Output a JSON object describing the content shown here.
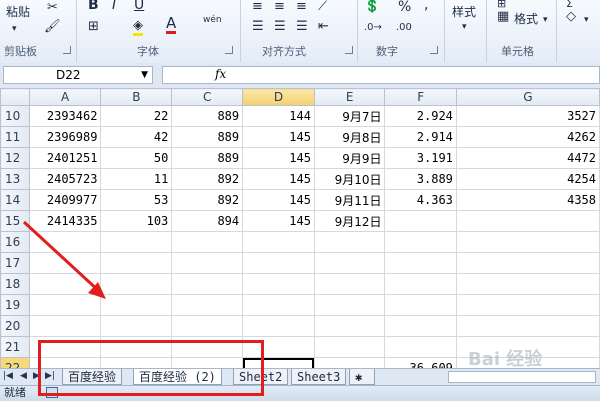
{
  "ribbon": {
    "clipboard": {
      "label": "剪贴板",
      "paste_label": "粘贴"
    },
    "font": {
      "label": "字体",
      "bold": "B",
      "italic": "I",
      "underline": "U",
      "font_color_glyph": "A",
      "wen_glyph": "wén"
    },
    "align": {
      "label": "对齐方式"
    },
    "number": {
      "label": "数字",
      "percent": "%",
      "comma": ","
    },
    "styles": {
      "label": "样式"
    },
    "cells": {
      "label": "单元格",
      "format_label": "格式"
    }
  },
  "formula_bar": {
    "name_box": "D22",
    "fx": "fx",
    "formula": ""
  },
  "columns": [
    "A",
    "B",
    "C",
    "D",
    "E",
    "F",
    "G"
  ],
  "selected_column": "D",
  "rows": [
    {
      "n": "10",
      "a": "2393462",
      "b": "22",
      "c": "889",
      "d": "144",
      "e": "9月7日",
      "f": "2.924",
      "g": "3527"
    },
    {
      "n": "11",
      "a": "2396989",
      "b": "42",
      "c": "889",
      "d": "145",
      "e": "9月8日",
      "f": "2.914",
      "g": "4262"
    },
    {
      "n": "12",
      "a": "2401251",
      "b": "50",
      "c": "889",
      "d": "145",
      "e": "9月9日",
      "f": "3.191",
      "g": "4472"
    },
    {
      "n": "13",
      "a": "2405723",
      "b": "11",
      "c": "892",
      "d": "145",
      "e": "9月10日",
      "f": "3.889",
      "g": "4254"
    },
    {
      "n": "14",
      "a": "2409977",
      "b": "53",
      "c": "892",
      "d": "145",
      "e": "9月11日",
      "f": "4.363",
      "g": "4358"
    },
    {
      "n": "15",
      "a": "2414335",
      "b": "103",
      "c": "894",
      "d": "145",
      "e": "9月12日",
      "f": "",
      "g": ""
    },
    {
      "n": "16",
      "a": "",
      "b": "",
      "c": "",
      "d": "",
      "e": "",
      "f": "",
      "g": ""
    },
    {
      "n": "17",
      "a": "",
      "b": "",
      "c": "",
      "d": "",
      "e": "",
      "f": "",
      "g": ""
    },
    {
      "n": "18",
      "a": "",
      "b": "",
      "c": "",
      "d": "",
      "e": "",
      "f": "",
      "g": ""
    },
    {
      "n": "19",
      "a": "",
      "b": "",
      "c": "",
      "d": "",
      "e": "",
      "f": "",
      "g": ""
    },
    {
      "n": "20",
      "a": "",
      "b": "",
      "c": "",
      "d": "",
      "e": "",
      "f": "",
      "g": ""
    },
    {
      "n": "21",
      "a": "",
      "b": "",
      "c": "",
      "d": "",
      "e": "",
      "f": "",
      "g": ""
    },
    {
      "n": "22",
      "a": "",
      "b": "",
      "c": "",
      "d": "",
      "e": "",
      "f": "36.609",
      "g": ""
    },
    {
      "n": "23",
      "a": "",
      "b": "",
      "c": "",
      "d": "",
      "e": "",
      "f": "",
      "g": ""
    }
  ],
  "active_cell": {
    "row": "22",
    "col": "D"
  },
  "sheet_tabs": [
    {
      "label": "百度经验",
      "active": false
    },
    {
      "label": "百度经验 (2)",
      "active": true
    },
    {
      "label": "Sheet2",
      "active": false
    },
    {
      "label": "Sheet3",
      "active": false
    }
  ],
  "status_bar": {
    "ready": "就绪"
  },
  "watermark": "Bai 经验",
  "colors": {
    "annotation_red": "#e21d1d",
    "selected_header": "#f8d978"
  }
}
